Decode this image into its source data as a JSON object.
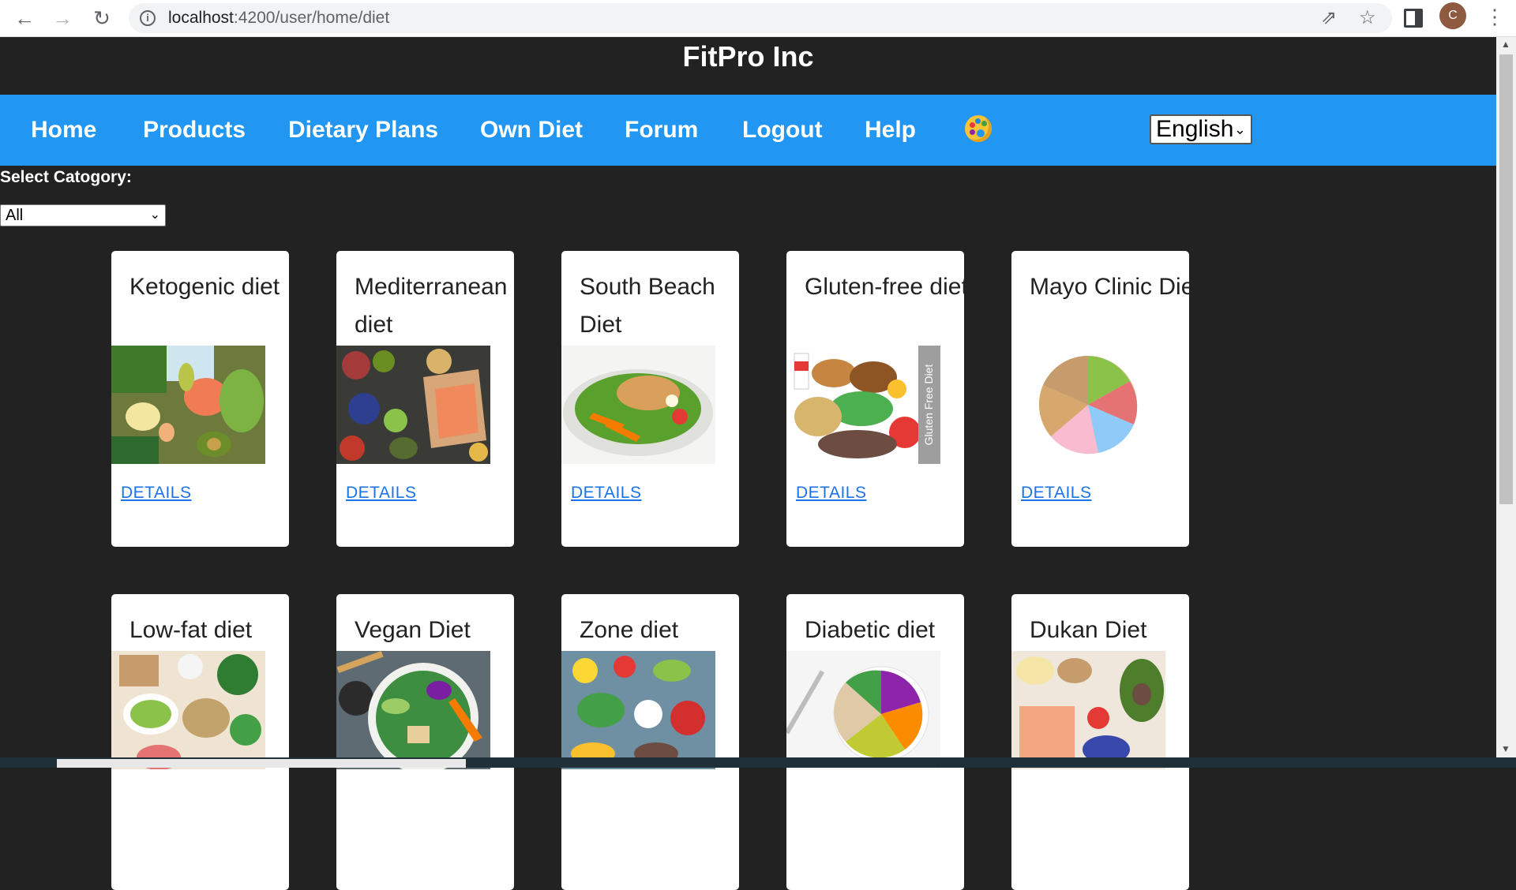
{
  "browser": {
    "url_host": "localhost",
    "url_rest": ":4200/user/home/diet",
    "avatar_letter": "C",
    "icons": [
      "back-arrow-icon",
      "forward-arrow-icon",
      "reload-icon",
      "info-icon",
      "share-icon",
      "star-icon",
      "side-panel-icon",
      "kebab-menu-icon"
    ]
  },
  "site": {
    "title": "FitPro Inc"
  },
  "nav": {
    "items": [
      {
        "label": "Home"
      },
      {
        "label": "Products"
      },
      {
        "label": "Dietary Plans"
      },
      {
        "label": "Own Diet"
      },
      {
        "label": "Forum"
      },
      {
        "label": "Logout"
      },
      {
        "label": "Help"
      }
    ],
    "theme_icon": "palette-icon",
    "language": "English"
  },
  "filter": {
    "label": "Select Catogory:",
    "selected": "All"
  },
  "cards": [
    {
      "title": "Ketogenic diet",
      "link": "DETAILS"
    },
    {
      "title": "Mediterranean diet",
      "link": "DETAILS"
    },
    {
      "title": "South Beach Diet",
      "link": "DETAILS"
    },
    {
      "title": "Gluten-free diet",
      "link": "DETAILS",
      "image_caption": "Gluten Free Diet"
    },
    {
      "title": "Mayo Clinic Diet",
      "link": "DETAILS"
    },
    {
      "title": "Low-fat diet"
    },
    {
      "title": "Vegan Diet"
    },
    {
      "title": "Zone diet"
    },
    {
      "title": "Diabetic diet"
    },
    {
      "title": "Dukan Diet"
    }
  ],
  "colors": {
    "header_bg": "#222222",
    "nav_bg": "#2196f3",
    "link": "#1a73e8"
  }
}
